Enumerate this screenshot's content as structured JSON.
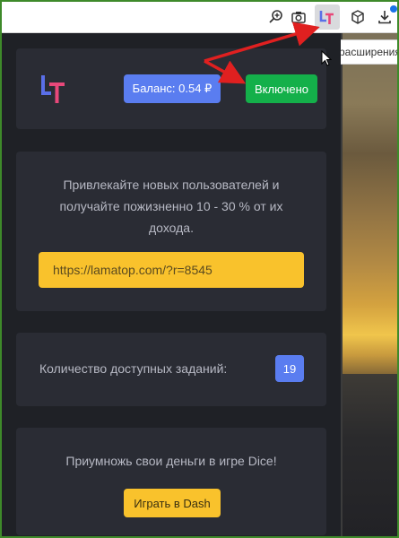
{
  "browser": {
    "toolbar_icons": [
      "zoom-in-icon",
      "camera-icon",
      "extension-lt-icon",
      "cube-icon",
      "download-icon"
    ],
    "background_tab_text": "расширения"
  },
  "popup": {
    "header": {
      "logo_text": "LT",
      "balance_label": "Баланс: 0.54 ₽",
      "status_label": "Включено"
    },
    "referral": {
      "text": "Привлекайте новых пользователей и получайте пожизненно 10 - 30 % от их дохода.",
      "link": "https://lamatop.com/?r=8545"
    },
    "tasks": {
      "label": "Количество доступных заданий:",
      "count": "19"
    },
    "dice": {
      "text": "Приумножь свои деньги в игре Dice!",
      "play_label": "Играть в Dash"
    }
  },
  "colors": {
    "background": "#1f2126",
    "card": "#2a2c34",
    "accent_blue": "#5a7df0",
    "accent_green": "#14b04a",
    "accent_yellow": "#f9c22c",
    "arrow_red": "#e02020",
    "frame_green": "#3e8a2a"
  }
}
